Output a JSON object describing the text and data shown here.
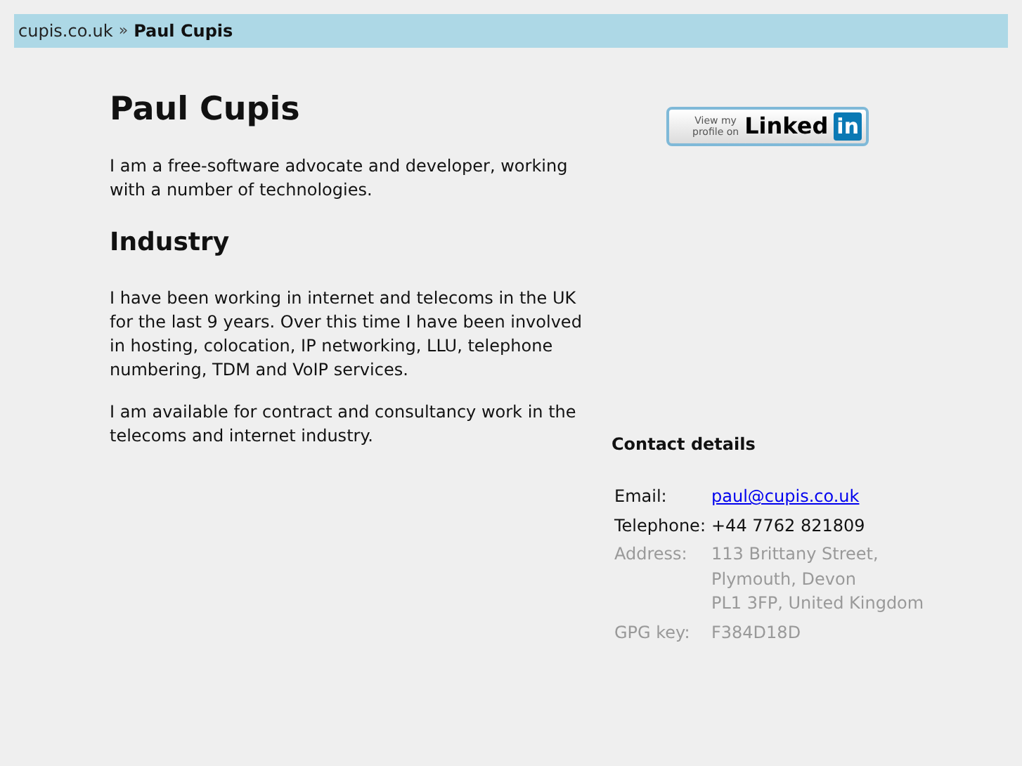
{
  "breadcrumb": {
    "home": "cupis.co.uk",
    "separator": "»",
    "current": "Paul Cupis"
  },
  "title": "Paul Cupis",
  "intro": "I am a free-software advocate and developer, working with a number of technologies.",
  "section": {
    "heading": "Industry",
    "paragraphs": [
      "I have been working in internet and telecoms in the UK for the last 9 years. Over this time I have been involved in hosting, colocation, IP networking, LLU, telephone numbering, TDM and VoIP services.",
      "I am available for contract and consultancy work in the telecoms and internet industry."
    ]
  },
  "linkedin_badge": {
    "caption_lines": [
      "View my",
      "profile on"
    ],
    "brand": "Linked",
    "brand_box": "in"
  },
  "contact": {
    "heading": "Contact details",
    "rows": [
      {
        "label": "Email:",
        "lines": [
          "paul@cupis.co.uk"
        ],
        "kind": "link",
        "dimmed": false
      },
      {
        "label": "Telephone:",
        "lines": [
          "+44 7762 821809"
        ],
        "kind": "text",
        "dimmed": false
      },
      {
        "label": "Address:",
        "lines": [
          "113 Brittany Street,",
          "Plymouth, Devon",
          "PL1 3FP, United Kingdom"
        ],
        "kind": "text",
        "dimmed": true
      },
      {
        "label": "GPG key:",
        "lines": [
          "F384D18D"
        ],
        "kind": "text",
        "dimmed": true
      }
    ]
  }
}
